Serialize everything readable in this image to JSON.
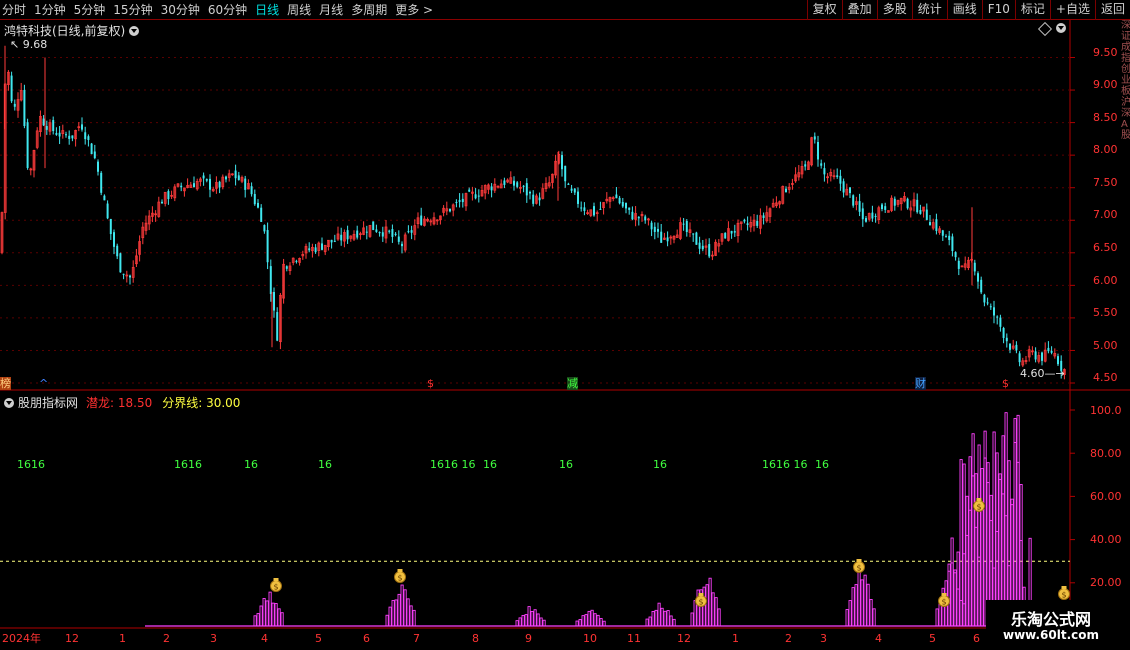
{
  "toolbar": {
    "timeframes": [
      {
        "label": "分时"
      },
      {
        "label": "1分钟"
      },
      {
        "label": "5分钟"
      },
      {
        "label": "15分钟"
      },
      {
        "label": "30分钟"
      },
      {
        "label": "60分钟"
      },
      {
        "label": "日线",
        "active": true
      },
      {
        "label": "周线"
      },
      {
        "label": "月线"
      },
      {
        "label": "多周期"
      },
      {
        "label": "更多 >"
      }
    ],
    "buttons": [
      "复权",
      "叠加",
      "多股",
      "统计",
      "画线",
      "F10",
      "标记",
      "+自选",
      "返回"
    ]
  },
  "main_panel": {
    "title": "鸿特科技(日线,前复权)",
    "high_label": "9.68",
    "low_label": "4.60",
    "y_ticks": [
      "9.50",
      "9.00",
      "8.50",
      "8.00",
      "7.50",
      "7.00",
      "6.50",
      "6.00",
      "5.50",
      "5.00",
      "4.50"
    ],
    "markers": [
      {
        "text": "榜",
        "color": "#e05020"
      },
      {
        "text": "^",
        "color": "#4080ff"
      },
      {
        "text": "$",
        "color": "#ff3030"
      },
      {
        "text": "减",
        "color": "#40ff40"
      },
      {
        "text": "财",
        "color": "#40a0ff"
      },
      {
        "text": "$",
        "color": "#ff3030"
      }
    ],
    "right_strip_text": "深证成指创业板沪深A股"
  },
  "indicator_panel": {
    "name": "股朋指标网",
    "qianlong_label": "潜龙: 18.50",
    "fenjie_label": "分界线: 30.00",
    "y_ticks": [
      "100.0",
      "80.00",
      "60.00",
      "40.00",
      "20.00"
    ],
    "sixteen_labels": [
      "1616",
      "1616",
      "16",
      "16",
      "1616 16",
      "16",
      "16",
      "16",
      "1616 16",
      "16"
    ]
  },
  "x_axis": {
    "labels": [
      "2024年",
      "12",
      "1",
      "2",
      "3",
      "4",
      "5",
      "6",
      "7",
      "8",
      "9",
      "10",
      "11",
      "12",
      "1",
      "2",
      "3",
      "4",
      "5",
      "6"
    ]
  },
  "watermark": {
    "line1": "乐淘公式网",
    "line2": "www.60lt.com"
  },
  "chart_data": {
    "type": "candlestick",
    "title": "鸿特科技(日线,前复权)",
    "y_range": [
      4.4,
      9.9
    ],
    "high": 9.68,
    "low": 4.6,
    "price_path": [
      [
        0,
        6.5
      ],
      [
        5,
        9.6
      ],
      [
        12,
        8.6
      ],
      [
        20,
        9.1
      ],
      [
        28,
        7.6
      ],
      [
        38,
        8.6
      ],
      [
        50,
        8.4
      ],
      [
        62,
        8.3
      ],
      [
        72,
        8.3
      ],
      [
        80,
        8.5
      ],
      [
        95,
        7.9
      ],
      [
        108,
        6.9
      ],
      [
        118,
        6.3
      ],
      [
        130,
        6.1
      ],
      [
        142,
        6.9
      ],
      [
        160,
        7.3
      ],
      [
        178,
        7.5
      ],
      [
        198,
        7.6
      ],
      [
        215,
        7.5
      ],
      [
        232,
        7.7
      ],
      [
        248,
        7.5
      ],
      [
        262,
        7.0
      ],
      [
        270,
        5.9
      ],
      [
        276,
        5.2
      ],
      [
        282,
        6.3
      ],
      [
        300,
        6.5
      ],
      [
        318,
        6.6
      ],
      [
        336,
        6.7
      ],
      [
        352,
        6.8
      ],
      [
        370,
        6.9
      ],
      [
        388,
        6.8
      ],
      [
        400,
        6.6
      ],
      [
        418,
        7.0
      ],
      [
        440,
        7.1
      ],
      [
        462,
        7.3
      ],
      [
        485,
        7.5
      ],
      [
        505,
        7.6
      ],
      [
        520,
        7.5
      ],
      [
        535,
        7.3
      ],
      [
        550,
        7.6
      ],
      [
        558,
        8.0
      ],
      [
        565,
        7.5
      ],
      [
        582,
        7.2
      ],
      [
        595,
        7.1
      ],
      [
        612,
        7.4
      ],
      [
        628,
        7.1
      ],
      [
        645,
        7.0
      ],
      [
        660,
        6.7
      ],
      [
        680,
        6.9
      ],
      [
        700,
        6.6
      ],
      [
        710,
        6.5
      ],
      [
        725,
        6.8
      ],
      [
        742,
        6.9
      ],
      [
        760,
        7.0
      ],
      [
        775,
        7.3
      ],
      [
        790,
        7.6
      ],
      [
        805,
        7.8
      ],
      [
        812,
        8.3
      ],
      [
        822,
        7.7
      ],
      [
        838,
        7.6
      ],
      [
        852,
        7.3
      ],
      [
        862,
        7.0
      ],
      [
        880,
        7.2
      ],
      [
        900,
        7.3
      ],
      [
        918,
        7.2
      ],
      [
        935,
        6.9
      ],
      [
        950,
        6.6
      ],
      [
        962,
        6.2
      ],
      [
        972,
        6.4
      ],
      [
        982,
        5.8
      ],
      [
        995,
        5.5
      ],
      [
        1008,
        5.1
      ],
      [
        1020,
        4.8
      ],
      [
        1030,
        4.95
      ],
      [
        1042,
        4.9
      ],
      [
        1052,
        5.0
      ],
      [
        1062,
        4.7
      ]
    ],
    "indicator": {
      "type": "histogram",
      "y_range": [
        0,
        100
      ],
      "qianlong": 18.5,
      "fenjie": 30.0,
      "clusters": [
        {
          "x": 268,
          "peak": 18
        },
        {
          "x": 400,
          "peak": 22
        },
        {
          "x": 530,
          "peak": 10
        },
        {
          "x": 590,
          "peak": 9
        },
        {
          "x": 660,
          "peak": 12
        },
        {
          "x": 705,
          "peak": 28
        },
        {
          "x": 860,
          "peak": 30
        },
        {
          "x": 950,
          "peak": 32
        },
        {
          "x": 970,
          "peak": 100
        },
        {
          "x": 985,
          "peak": 100
        },
        {
          "x": 1000,
          "peak": 100
        },
        {
          "x": 1015,
          "peak": 100
        }
      ]
    }
  }
}
